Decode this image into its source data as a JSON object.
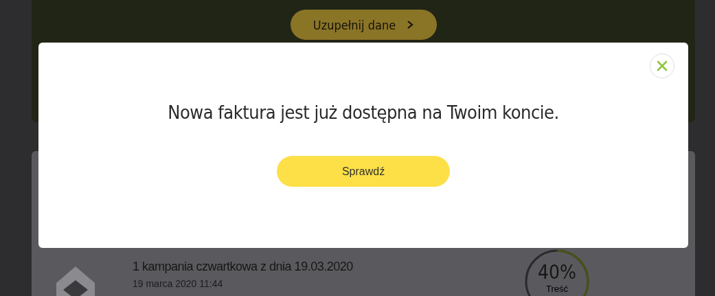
{
  "banner": {
    "button": "Uzupełnij dane"
  },
  "campaigns": [
    {
      "title": "1 kampania czwartkowa z dnia 19.03.2020",
      "date": "19 marca 2020 11:44",
      "percent": "40%",
      "percent_label": "Treść",
      "level": 0.4
    }
  ],
  "modal": {
    "message": "Nowa faktura jest już dostępna na Twoim koncie.",
    "button": "Sprawdź"
  }
}
